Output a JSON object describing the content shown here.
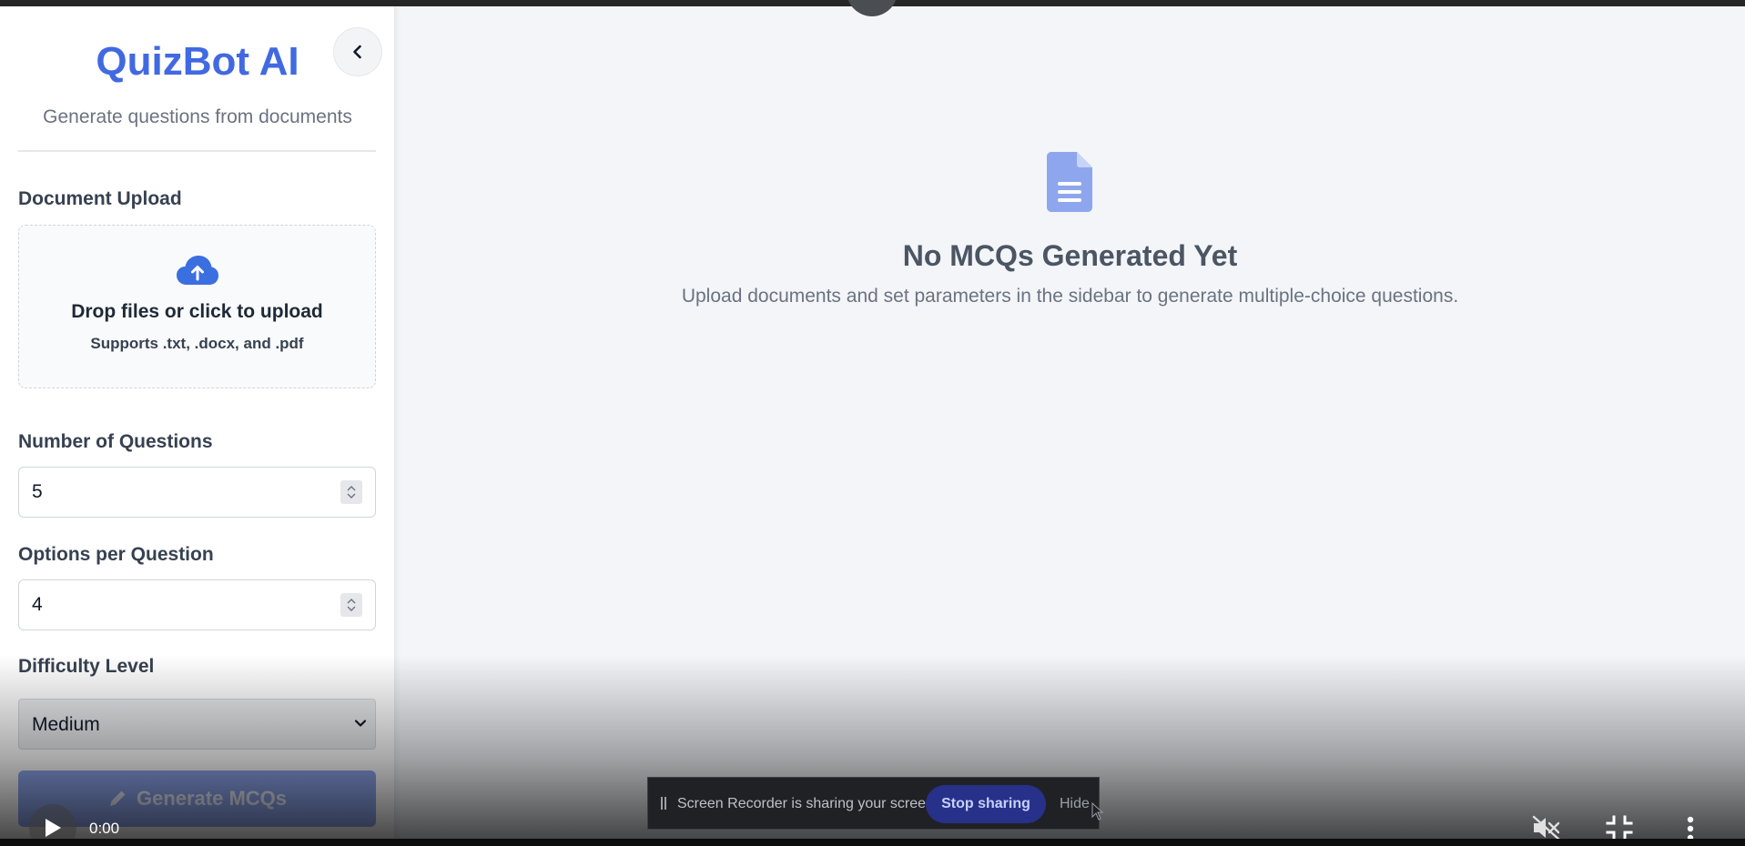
{
  "sidebar": {
    "collapse_icon": "chevron-left-icon",
    "title": "QuizBot AI",
    "subtitle": "Generate questions from documents",
    "upload": {
      "label": "Document Upload",
      "icon": "cloud-upload-icon",
      "title": "Drop files or click to upload",
      "hint": "Supports .txt, .docx, and .pdf"
    },
    "num_questions": {
      "label": "Number of Questions",
      "value": "5"
    },
    "options_per_question": {
      "label": "Options per Question",
      "value": "4"
    },
    "difficulty": {
      "label": "Difficulty Level",
      "selected": "Medium"
    },
    "generate_button": {
      "label": "Generate MCQs",
      "icon": "pencil-icon"
    }
  },
  "main": {
    "empty_icon": "document-icon",
    "empty_title": "No MCQs Generated Yet",
    "empty_description": "Upload documents and set parameters in the sidebar to generate multiple-choice questions."
  },
  "share_banner": {
    "message": "Screen Recorder is sharing your screen.",
    "stop_label": "Stop sharing",
    "hide_label": "Hide"
  },
  "video_controls": {
    "time": "0:00",
    "icons": [
      "play-icon",
      "muted-icon",
      "exit-fullscreen-icon",
      "more-vert-icon"
    ]
  },
  "colors": {
    "brand": "#4169e1",
    "generate_button": "#8ea6ee",
    "main_background": "#f3f5f9",
    "doc_icon": "#8ea6ee"
  }
}
